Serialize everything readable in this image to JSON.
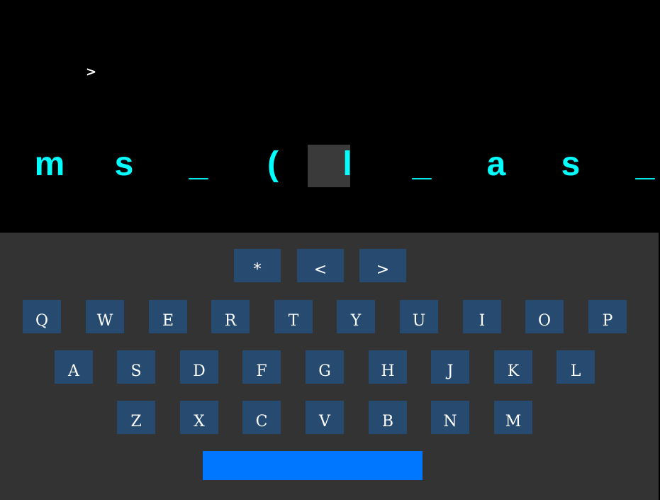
{
  "prompt": ">",
  "text_display": {
    "characters": [
      "m",
      "s",
      "_",
      "(",
      "l",
      "_",
      "a",
      "s",
      "_"
    ],
    "cursor_index": 4
  },
  "colors": {
    "background": "#000000",
    "text": "#00ffff",
    "keyboard_background": "#333333",
    "key_background": "#264a70",
    "space_key": "#0077ff"
  },
  "keyboard": {
    "special_row": [
      "*",
      "<",
      ">"
    ],
    "row1": [
      "Q",
      "W",
      "E",
      "R",
      "T",
      "Y",
      "U",
      "I",
      "O",
      "P"
    ],
    "row2": [
      "A",
      "S",
      "D",
      "F",
      "G",
      "H",
      "J",
      "K",
      "L"
    ],
    "row3": [
      "Z",
      "X",
      "C",
      "V",
      "B",
      "N",
      "M"
    ]
  }
}
